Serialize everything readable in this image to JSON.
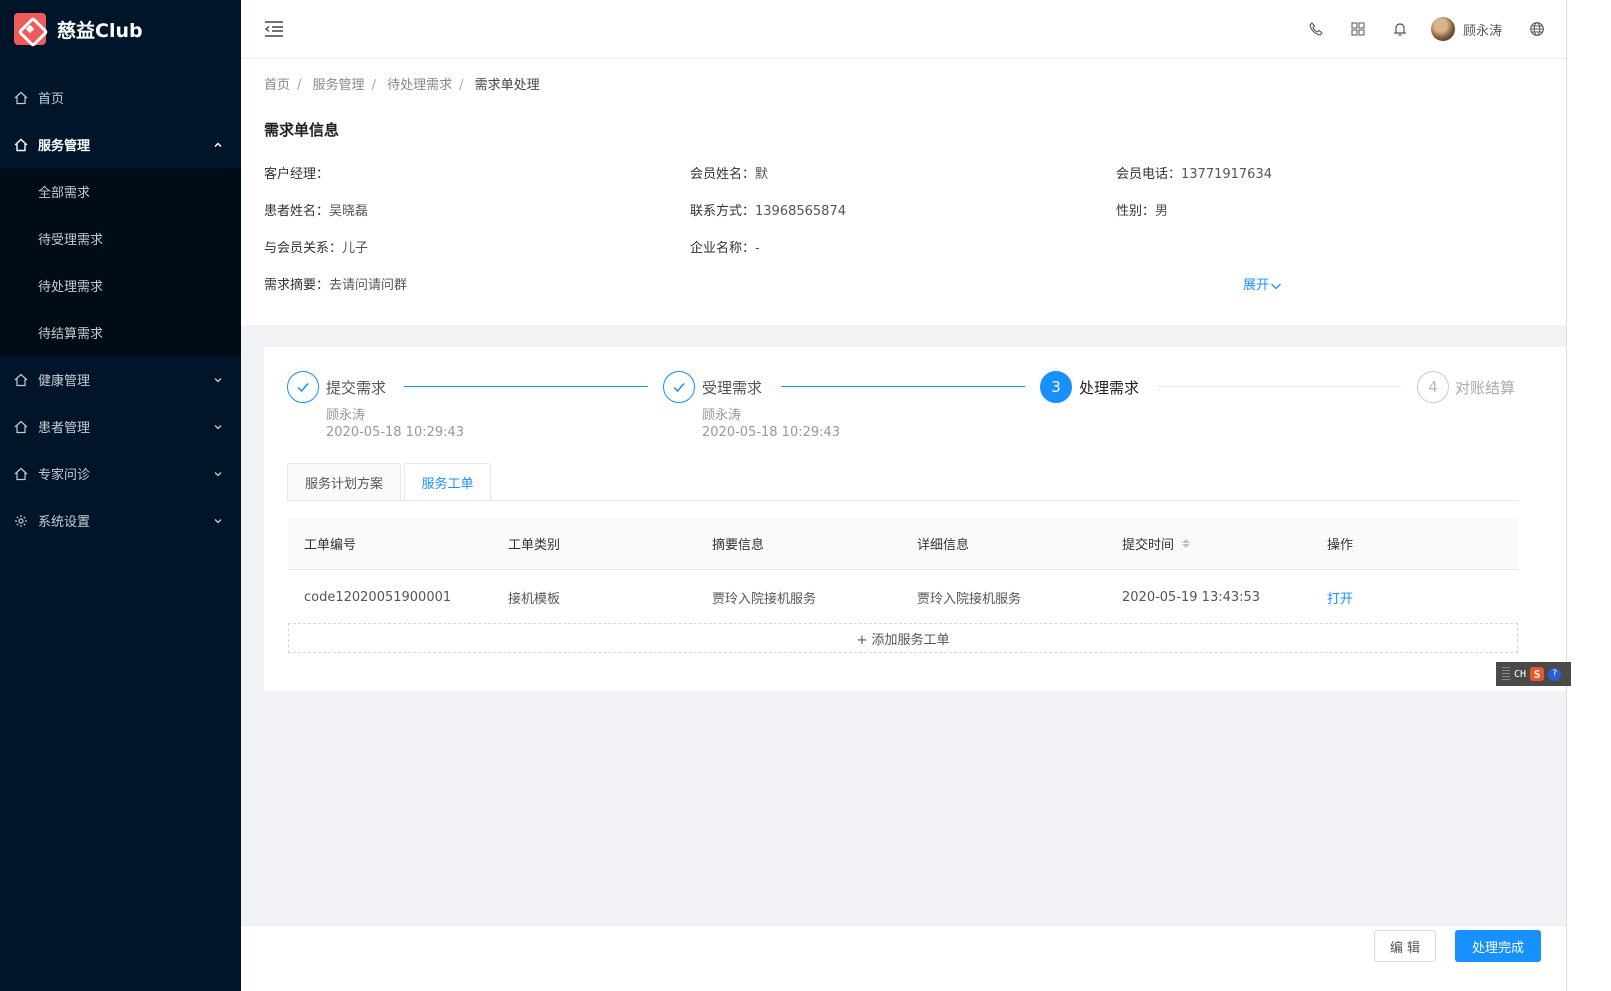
{
  "app": {
    "name": "慈益Club"
  },
  "sidebar": {
    "items": [
      {
        "label": "首页"
      },
      {
        "label": "服务管理"
      },
      {
        "label": "全部需求"
      },
      {
        "label": "待受理需求"
      },
      {
        "label": "待处理需求"
      },
      {
        "label": "待结算需求"
      },
      {
        "label": "健康管理"
      },
      {
        "label": "患者管理"
      },
      {
        "label": "专家问诊"
      },
      {
        "label": "系统设置"
      }
    ]
  },
  "header": {
    "username": "顾永涛"
  },
  "breadcrumb": [
    "首页",
    "服务管理",
    "待处理需求",
    "需求单处理"
  ],
  "info": {
    "title": "需求单信息",
    "fields": [
      {
        "label": "客户经理：",
        "value": ""
      },
      {
        "label": "会员姓名：",
        "value": "默"
      },
      {
        "label": "会员电话：",
        "value": "13771917634"
      },
      {
        "label": "患者姓名：",
        "value": "吴晓磊"
      },
      {
        "label": "联系方式：",
        "value": "13968565874"
      },
      {
        "label": "性别：",
        "value": "男"
      },
      {
        "label": "与会员关系：",
        "value": "儿子"
      },
      {
        "label": "企业名称：",
        "value": "-"
      },
      {
        "label": "需求摘要：",
        "value": "去请问请问群"
      }
    ],
    "expand_label": "展开"
  },
  "steps": [
    {
      "title": "提交需求",
      "user": "顾永涛",
      "time": "2020-05-18 10:29:43",
      "status": "finish"
    },
    {
      "title": "受理需求",
      "user": "顾永涛",
      "time": "2020-05-18 10:29:43",
      "status": "finish"
    },
    {
      "number": "3",
      "title": "处理需求",
      "status": "process"
    },
    {
      "number": "4",
      "title": "对账结算",
      "status": "wait"
    }
  ],
  "tabs": [
    {
      "label": "服务计划方案",
      "active": false
    },
    {
      "label": "服务工单",
      "active": true
    }
  ],
  "table": {
    "columns": [
      "工单编号",
      "工单类别",
      "摘要信息",
      "详细信息",
      "提交时间",
      "操作"
    ],
    "rows": [
      {
        "code": "code12020051900001",
        "category": "接机模板",
        "summary": "贾玲入院接机服务",
        "detail": "贾玲入院接机服务",
        "time": "2020-05-19 13:43:53",
        "action": "打开"
      }
    ],
    "add_label": "+ 添加服务工单"
  },
  "ime": {
    "lang": "CH",
    "logo": "S",
    "help": "?"
  },
  "footer": {
    "edit_label": "编 辑",
    "complete_label": "处理完成"
  },
  "colors": {
    "primary": "#1890ff",
    "sidebar_bg": "#001529",
    "logo": "#f25a5a"
  }
}
